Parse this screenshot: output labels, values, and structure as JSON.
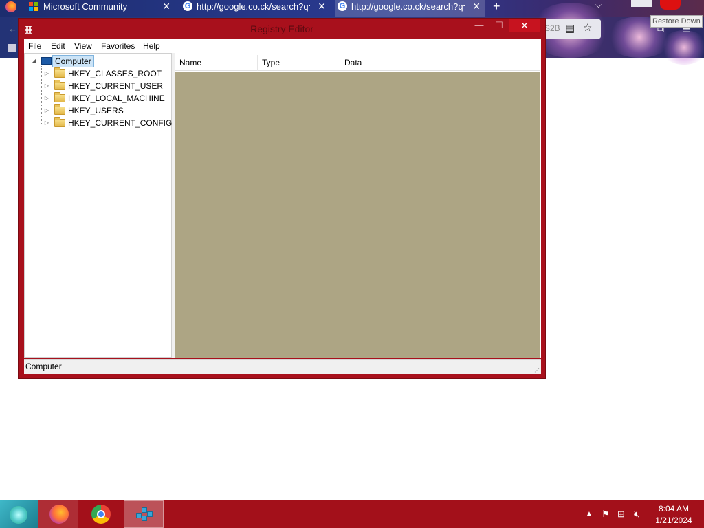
{
  "browser": {
    "tabs": [
      {
        "label": "Microsoft Community",
        "close": "✕"
      },
      {
        "label": "http://google.co.ck/search?q=",
        "close": "✕"
      },
      {
        "label": "http://google.co.ck/search?q=",
        "close": "✕"
      }
    ],
    "new_tab": "+",
    "addr_fragment": "S2B",
    "tooltip": "Restore Down"
  },
  "window": {
    "title": "Registry Editor",
    "minimize": "—",
    "maximize": "☐",
    "close": "✕"
  },
  "menu": {
    "file": "File",
    "edit": "Edit",
    "view": "View",
    "favorites": "Favorites",
    "help": "Help"
  },
  "tree": {
    "root": "Computer",
    "hives": [
      "HKEY_CLASSES_ROOT",
      "HKEY_CURRENT_USER",
      "HKEY_LOCAL_MACHINE",
      "HKEY_USERS",
      "HKEY_CURRENT_CONFIG"
    ]
  },
  "values": {
    "columns": [
      "Name",
      "Type",
      "Data"
    ]
  },
  "status": {
    "path": "Computer"
  },
  "taskbar": {
    "time": "8:04 AM",
    "date": "1/21/2024"
  },
  "colors": {
    "window_frame": "#a8101c",
    "close_button": "#c7131f",
    "values_background": "#ada584",
    "taskbar": "#a3101a"
  }
}
